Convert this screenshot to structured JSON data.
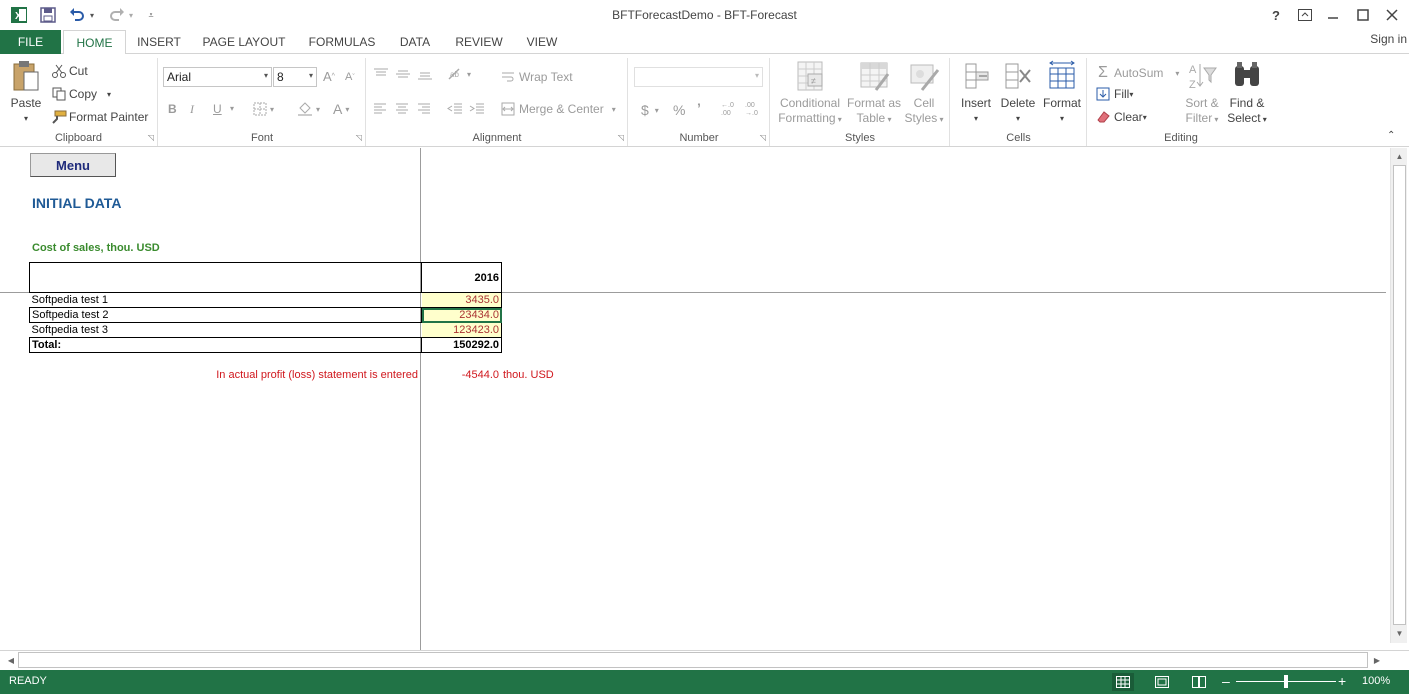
{
  "window": {
    "title": "BFTForecastDemo - BFT-Forecast",
    "help": "?",
    "sign_in": "Sign in"
  },
  "tabs": {
    "file": "FILE",
    "items": [
      "HOME",
      "INSERT",
      "PAGE LAYOUT",
      "FORMULAS",
      "DATA",
      "REVIEW",
      "VIEW"
    ],
    "active": "HOME"
  },
  "ribbon": {
    "clipboard": {
      "label": "Clipboard",
      "paste": "Paste",
      "cut": "Cut",
      "copy": "Copy",
      "format_painter": "Format Painter"
    },
    "font": {
      "label": "Font",
      "font_name": "Arial",
      "font_size": "8",
      "bold": "B",
      "italic": "I",
      "underline": "U",
      "grow": "A",
      "shrink": "A",
      "font_color": "A"
    },
    "alignment": {
      "label": "Alignment",
      "wrap_text": "Wrap Text",
      "merge_center": "Merge & Center"
    },
    "number": {
      "label": "Number",
      "format_value": "",
      "currency": "$",
      "percent": "%",
      "comma": "’",
      "inc_decimal": "←.0 .00",
      "dec_decimal": ".00 →.0"
    },
    "styles": {
      "label": "Styles",
      "conditional_1": "Conditional",
      "conditional_2": "Formatting",
      "format_table_1": "Format as",
      "format_table_2": "Table",
      "cell_styles_1": "Cell",
      "cell_styles_2": "Styles"
    },
    "cells": {
      "label": "Cells",
      "insert": "Insert",
      "delete": "Delete",
      "format": "Format"
    },
    "editing": {
      "label": "Editing",
      "autosum": "AutoSum",
      "fill": "Fill",
      "clear": "Clear",
      "sort_1": "Sort &",
      "sort_2": "Filter",
      "find_1": "Find &",
      "find_2": "Select"
    }
  },
  "sheet": {
    "menu_button": "Menu",
    "heading": "INITIAL DATA",
    "cost_label": "Cost of sales, thou. USD",
    "table": {
      "year": "2016",
      "rows": [
        {
          "label": "Softpedia test 1",
          "value": "3435.0"
        },
        {
          "label": "Softpedia test 2",
          "value": "23434.0"
        },
        {
          "label": "Softpedia test 3",
          "value": "123423.0"
        }
      ],
      "total_label": "Total:",
      "total_value": "150292.0"
    },
    "profit_note": "In actual profit (loss) statement is entered",
    "profit_value": "-4544.0",
    "profit_unit": "thou. USD"
  },
  "status": {
    "text": "READY",
    "zoom": "100%",
    "zoom_fraction": 0.5
  },
  "colors": {
    "excel_green": "#217346",
    "heading_blue": "#1f5a96",
    "label_green": "#3a8b2e",
    "alert_red": "#d0171d",
    "input_yellow": "#ffffcc"
  }
}
